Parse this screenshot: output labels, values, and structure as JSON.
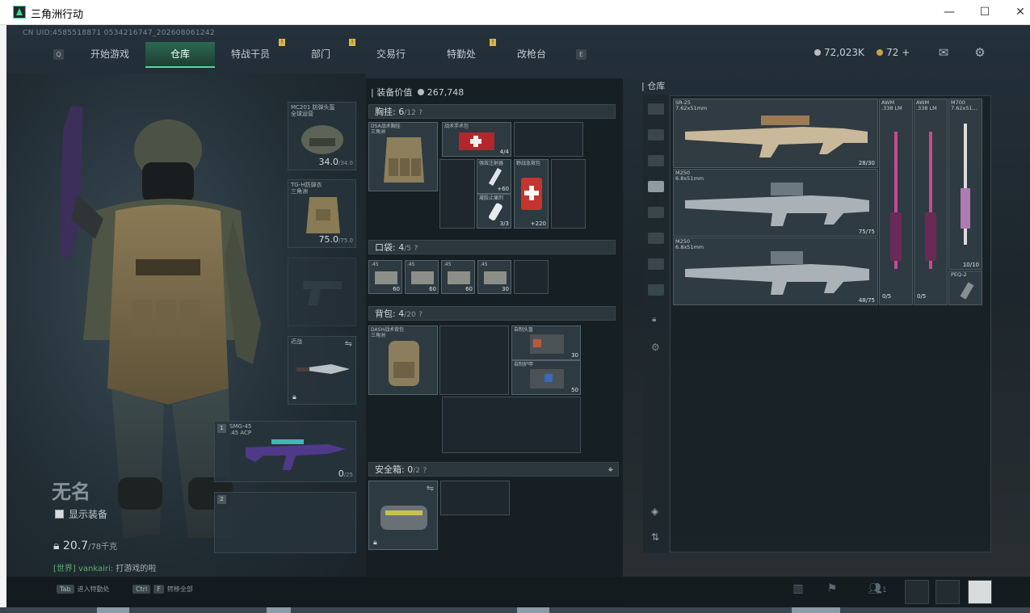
{
  "window": {
    "title": "三角洲行动"
  },
  "uid": "CN UID:4585518871 0534216747_202608061242",
  "nav": {
    "key_left": "Q",
    "key_right": "E",
    "tabs": [
      {
        "label": "开始游戏",
        "badge": ""
      },
      {
        "label": "仓库",
        "badge": ""
      },
      {
        "label": "特战干员",
        "badge": "!"
      },
      {
        "label": "部门",
        "badge": "!"
      },
      {
        "label": "交易行",
        "badge": ""
      },
      {
        "label": "特勤处",
        "badge": "!"
      },
      {
        "label": "改枪台",
        "badge": ""
      }
    ]
  },
  "currency": {
    "silver": "72,023K",
    "gold": "72 +"
  },
  "character": {
    "name": "无名",
    "show_equipment": "显示装备",
    "weight": "20.7",
    "weight_max": "/78千克"
  },
  "chat": {
    "channel": "[世界]",
    "user": "vankairi:",
    "message": "打游戏的啦"
  },
  "equipment": {
    "helmet": {
      "name": "MC201 防弹头盔",
      "sub": "全球运营",
      "durability": "34.0",
      "max": "/34.0"
    },
    "armor": {
      "name": "TG-H防弹衣",
      "sub": "三角洲",
      "durability": "75.0",
      "max": "/75.0"
    },
    "melee": {
      "name": "近战"
    },
    "primary": {
      "index": "1",
      "name": "SMG-45",
      "caliber": ".45 ACP",
      "ammo": "0",
      "ammo_max": "/25"
    },
    "secondary": {
      "index": "2"
    }
  },
  "inventory": {
    "value_label": "装备价值",
    "value": "267,748",
    "chest": {
      "label": "胸挂:",
      "count": "6",
      "capacity": "/12",
      "rig_name": "DSA战术胸挂",
      "rig_sub": "三角洲",
      "items": [
        {
          "label": "战术手术包",
          "count": "4/4"
        },
        {
          "label": "强效注射器",
          "count": "+60"
        },
        {
          "label": "凝胶止痛剂",
          "count": "3/3"
        },
        {
          "label": "野战急救包",
          "count": "+220"
        }
      ]
    },
    "pocket": {
      "label": "口袋:",
      "count": "4",
      "capacity": "/5",
      "items": [
        {
          "label": ".45",
          "count": "60"
        },
        {
          "label": ".45",
          "count": "60"
        },
        {
          "label": ".45",
          "count": "60"
        },
        {
          "label": ".45",
          "count": "30"
        }
      ]
    },
    "backpack": {
      "label": "背包:",
      "count": "4",
      "capacity": "/20",
      "bag_name": "DASH战术背包",
      "bag_sub": "三角洲",
      "items": [
        {
          "label": "自制头盔",
          "count": "30"
        },
        {
          "label": "自制护甲",
          "count": "50"
        }
      ]
    },
    "safebox": {
      "label": "安全箱:",
      "count": "0",
      "capacity": "/2"
    }
  },
  "stash": {
    "title": "仓库",
    "items": [
      {
        "name": "SR-25",
        "caliber": "7.62x51mm",
        "ammo": "28/30"
      },
      {
        "name": "AWM",
        "caliber": ".338 LM",
        "ammo": ""
      },
      {
        "name": "AWM",
        "caliber": ".338 LM",
        "ammo": ""
      },
      {
        "name": "M700",
        "caliber": "7.62x51...",
        "ammo": "10/10"
      },
      {
        "name": "M250",
        "caliber": "6.8x51mm",
        "ammo": "75/75"
      },
      {
        "name": "M250",
        "caliber": "6.8x51mm",
        "ammo": "48/75"
      },
      {
        "name": "PEQ-2",
        "caliber": "",
        "ammo": ""
      }
    ],
    "extra_counts": [
      "0/5",
      "0/5"
    ]
  },
  "bottom": {
    "hint1_key": "Tab",
    "hint1_label": "进入特勤处",
    "hint2_key1": "Ctrl",
    "hint2_key2": "F",
    "hint2_label": "转移全部",
    "team_count": "1"
  },
  "colors": {
    "accent": "#55d69a",
    "badge": "#d8b64c",
    "background": "#1c2226"
  }
}
